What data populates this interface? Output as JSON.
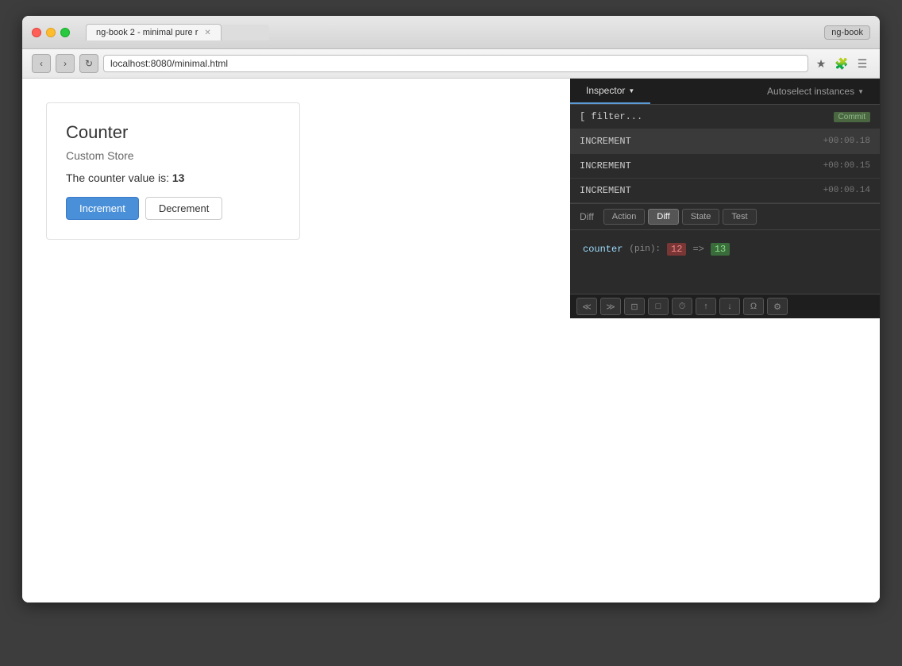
{
  "browser": {
    "tab_title": "ng-book 2 - minimal pure r",
    "url": "localhost:8080/minimal.html",
    "extensions_label": "ng-book"
  },
  "counter": {
    "title": "Counter",
    "store_label": "Custom Store",
    "value_prefix": "The counter value is: ",
    "value": "13",
    "increment_label": "Increment",
    "decrement_label": "Decrement"
  },
  "devtools": {
    "inspector_label": "Inspector",
    "inspector_arrow": "▼",
    "autoselect_label": "Autoselect instances",
    "autoselect_arrow": "▼",
    "actions": [
      {
        "name": "INCREMENT",
        "time": "+00:00.18",
        "badge": "Commit"
      },
      {
        "name": "INCREMENT",
        "time": "+00:00.15"
      },
      {
        "name": "INCREMENT",
        "time": "+00:00.14"
      }
    ],
    "detail": {
      "label": "Diff",
      "tabs": [
        "Action",
        "Diff",
        "State",
        "Test"
      ],
      "active_tab": "Diff",
      "diff_key": "counter",
      "diff_pin": "(pin):",
      "diff_old": "12",
      "diff_arrow": "=>",
      "diff_new": "13"
    },
    "bottom_buttons": [
      "≪",
      "≫",
      "⊡",
      "□",
      "⏱",
      "↑",
      "↓",
      "Ω",
      "⚙"
    ]
  }
}
